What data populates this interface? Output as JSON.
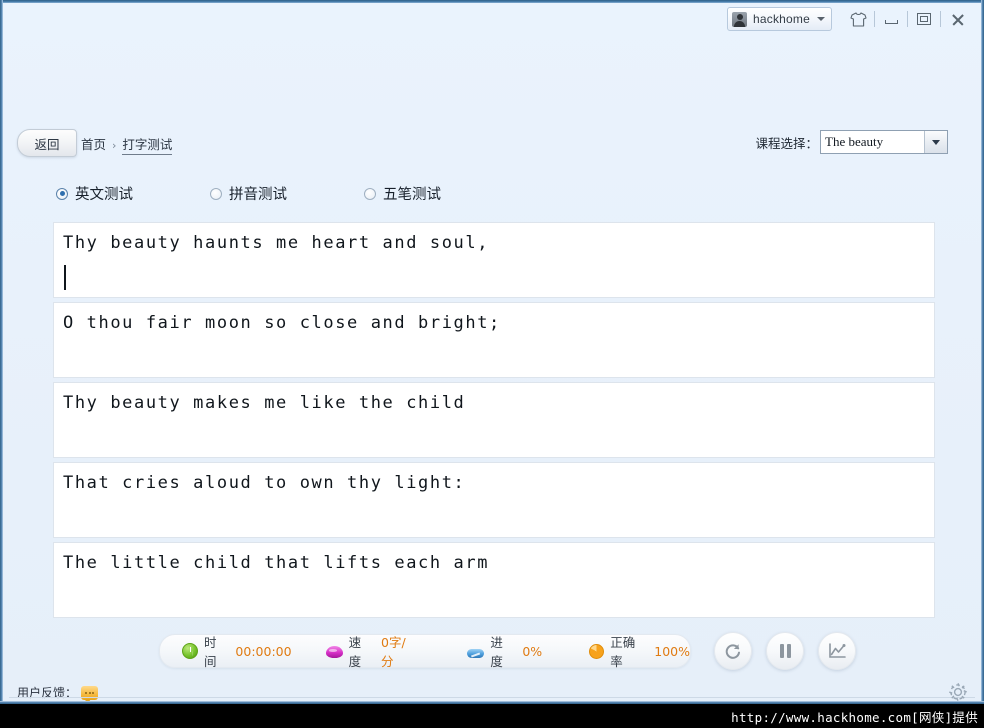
{
  "titlebar": {
    "account_name": "hackhome",
    "caret_icon": "chevron-down-icon",
    "skin_icon": "shirt-icon",
    "minimize_icon": "minimize-icon",
    "maximize_icon": "maximize-icon",
    "close_icon": "close-icon"
  },
  "nav": {
    "back_label": "返回",
    "breadcrumb_home": "首页",
    "breadcrumb_sep": "›",
    "breadcrumb_current": "打字测试"
  },
  "course": {
    "label": "课程选择：",
    "selected": "The beauty",
    "arrow_icon": "chevron-down-icon"
  },
  "modes": [
    {
      "label": "英文测试",
      "checked": true
    },
    {
      "label": "拼音测试",
      "checked": false
    },
    {
      "label": "五笔测试",
      "checked": false
    }
  ],
  "lines": [
    {
      "text": "Thy beauty haunts me heart and soul,",
      "caret": true
    },
    {
      "text": "O thou fair moon so close and bright;",
      "caret": false
    },
    {
      "text": "Thy beauty makes me like the child",
      "caret": false
    },
    {
      "text": "That cries aloud to own thy light:",
      "caret": false
    },
    {
      "text": "The little child that lifts each arm",
      "caret": false
    }
  ],
  "status": {
    "time_label": "时间",
    "time_value": "00:00:00",
    "speed_label": "速度",
    "speed_value": "0字/分",
    "progress_label": "进度",
    "progress_value": "0%",
    "accuracy_label": "正确率",
    "accuracy_value": "100%",
    "time_icon": "clock-icon",
    "speed_icon": "gem-icon",
    "progress_icon": "progress-pill-icon",
    "accuracy_icon": "pie-chart-icon"
  },
  "controls": {
    "restart_icon": "restart-icon",
    "pause_icon": "pause-icon",
    "stats_icon": "line-chart-icon"
  },
  "footer": {
    "feedback_label": "用户反馈：",
    "feedback_icon": "speech-bubble-icon",
    "settings_icon": "gear-icon"
  },
  "watermark": {
    "text": "http://www.hackhome.com[网侠]提供"
  },
  "colors": {
    "accent_orange": "#e07b12",
    "window_bg": "#e9f2fc",
    "frame_blue": "#2e5f86"
  }
}
